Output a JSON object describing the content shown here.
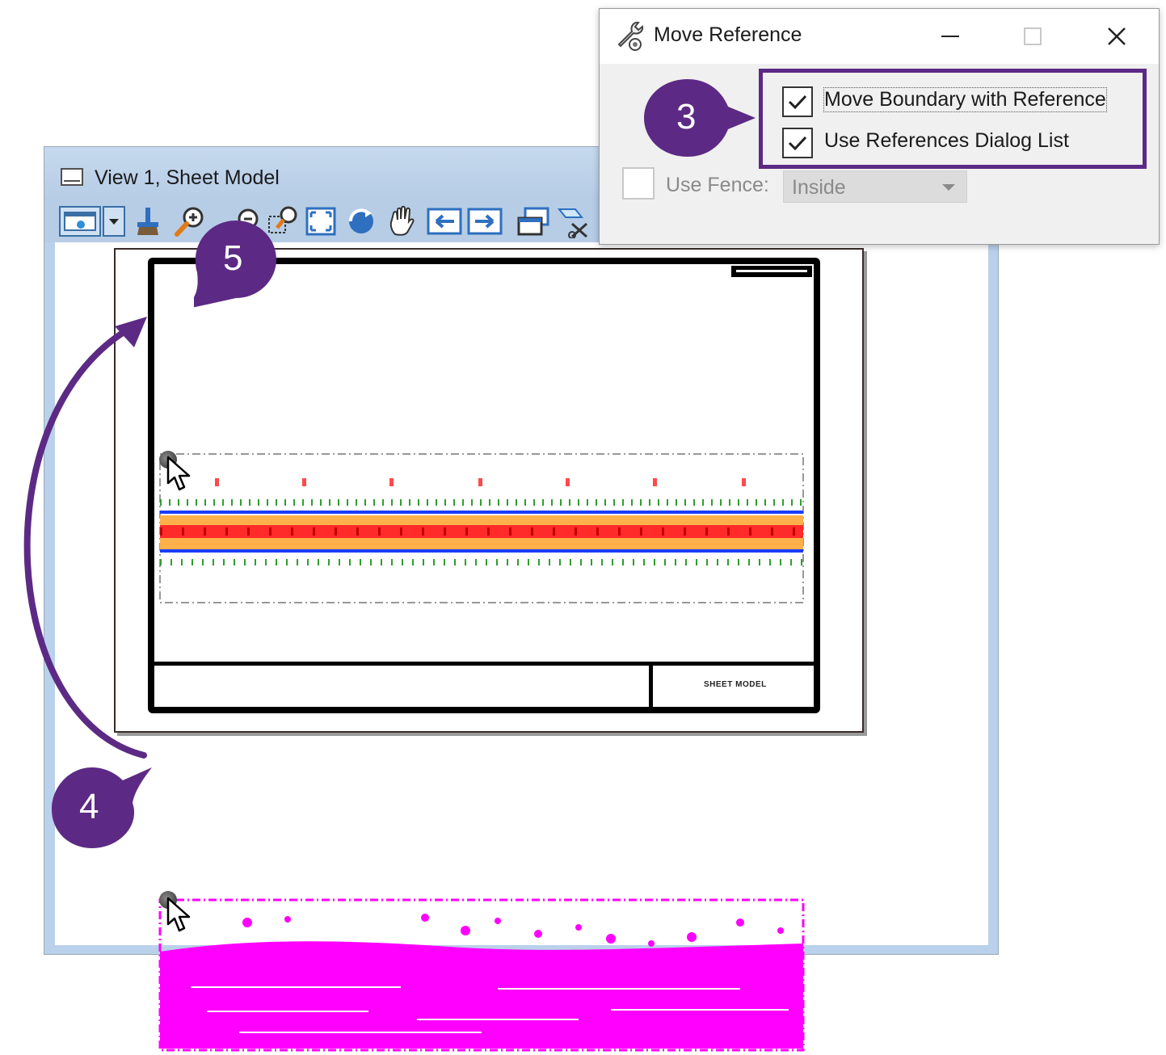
{
  "dialog": {
    "title": "Move Reference",
    "options": {
      "move_boundary": {
        "label": "Move Boundary with Reference",
        "checked": true
      },
      "use_references_list": {
        "label": "Use References Dialog List",
        "checked": true
      },
      "use_fence": {
        "label": "Use Fence:",
        "checked": false,
        "enabled": false
      }
    },
    "fence_mode": {
      "value": "Inside",
      "enabled": false
    }
  },
  "view": {
    "title": "View 1, Sheet Model",
    "toolbar_icons": [
      "view-attributes-icon",
      "dropdown-arrow-icon",
      "update-view-icon",
      "zoom-in-icon",
      "zoom-out-icon",
      "window-area-icon",
      "fit-view-icon",
      "rotate-view-icon",
      "pan-view-icon",
      "view-previous-icon",
      "view-next-icon",
      "copy-view-icon",
      "clip-volume-icon",
      "clip-mask-icon"
    ],
    "sheet": {
      "footer_label": "SHEET MODEL"
    }
  },
  "callouts": {
    "step3": "3",
    "step4": "4",
    "step5": "5"
  },
  "colors": {
    "callout": "#5c2a84",
    "highlight": "#5c2a84",
    "reference_moving": "#ff00ff",
    "road_red": "#ff2a2a",
    "road_orange": "#ffb04a",
    "road_blue": "#1a3cff",
    "road_green": "#2e9e2e"
  }
}
